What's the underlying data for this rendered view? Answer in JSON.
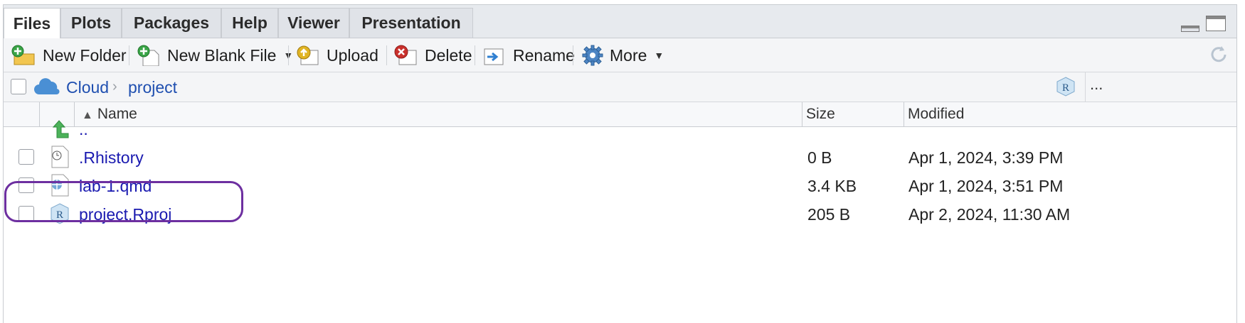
{
  "tabs": [
    "Files",
    "Plots",
    "Packages",
    "Help",
    "Viewer",
    "Presentation"
  ],
  "toolbar": {
    "new_folder": "New Folder",
    "new_blank_file": "New Blank File",
    "upload": "Upload",
    "delete": "Delete",
    "rename": "Rename",
    "more": "More"
  },
  "path": {
    "root": "Cloud",
    "folder": "project",
    "overflow": "..."
  },
  "table": {
    "headers": {
      "name": "Name",
      "size": "Size",
      "modified": "Modified"
    },
    "parent": {
      "name": ".."
    },
    "rows": [
      {
        "name": ".Rhistory",
        "size": "0 B",
        "modified": "Apr 1, 2024, 3:39 PM",
        "icon": "history-file-icon"
      },
      {
        "name": "lab-1.qmd",
        "size": "3.4 KB",
        "modified": "Apr 1, 2024, 3:51 PM",
        "icon": "quarto-file-icon"
      },
      {
        "name": "project.Rproj",
        "size": "205 B",
        "modified": "Apr 2, 2024, 11:30 AM",
        "icon": "rproj-file-icon"
      }
    ]
  },
  "colors": {
    "link": "#1a1ab0",
    "highlight": "#6d2fa0",
    "cloud": "#4a8fd4"
  }
}
